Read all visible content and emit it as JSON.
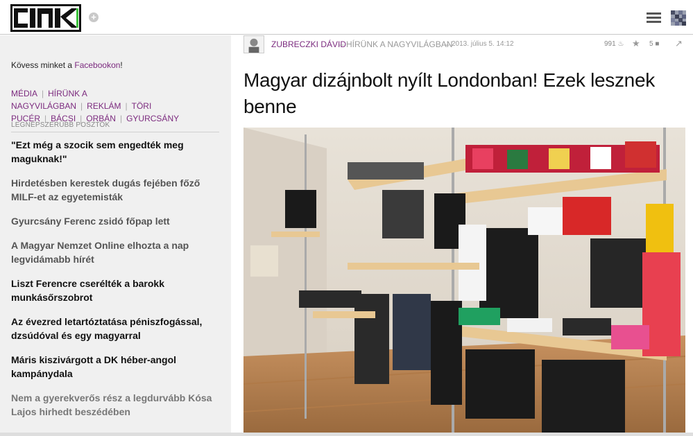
{
  "header": {
    "logo_icon": "cink-logo",
    "plus_icon": "plus-icon",
    "menu_icon": "hamburger-menu-icon",
    "avatar_icon": "user-avatar-icon"
  },
  "sidebar": {
    "follow_prefix": "Kövess minket a ",
    "follow_link": "Facebookon",
    "follow_suffix": "!",
    "categories": [
      "MÉDIA",
      "HÍRÜNK A NAGYVILÁGBAN",
      "REKLÁM",
      "TÖRI",
      "PUCÉR",
      "BÁCSI",
      "ORBÁN",
      "GYURCSÁNY"
    ],
    "popular_heading": "LEGNÉPSZERŰBB POSZTOK",
    "posts": [
      "\"Ezt még a szocik sem engedték meg maguknak!\"",
      "Hirdetésben kerestek dugás fejében főző MILF-et az egyetemisták",
      "Gyurcsány Ferenc zsidó főpap lett",
      "A Magyar Nemzet Online elhozta a nap legvidámabb hírét",
      "Liszt Ferencre cserélték a barokk munkásőrszobrot",
      "Az évezred letartóztatása péniszfogással, dzsúdóval és egy magyarral",
      "Máris kiszivárgott a DK héber-angol kampánydala",
      "Nem a gyerekverős rész a legdurvább Kósa Lajos hirhedt beszédében"
    ]
  },
  "article": {
    "author": "ZUBRECZKI DÁVID",
    "separator": "–",
    "category": "HÍRÜNK A NAGYVILÁGBAN",
    "date": "2013. július 5. 14:12",
    "views": "991",
    "comments": "5",
    "title": "Magyar dizájnbolt nyílt Londonban! Ezek lesznek benne",
    "photo_icon": "shop-interior-photo"
  },
  "colors": {
    "accent": "#7b2a7e",
    "sidebar_bg": "#f0f0f0"
  }
}
